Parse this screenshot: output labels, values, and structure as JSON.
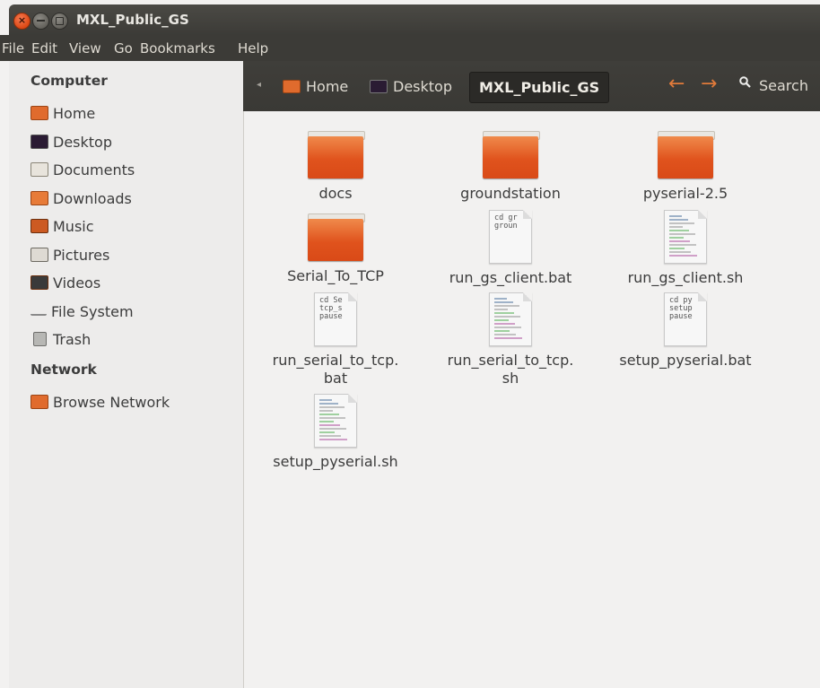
{
  "window": {
    "title": "MXL_Public_GS",
    "close_glyph": "×"
  },
  "menu": [
    "File",
    "Edit",
    "View",
    "Go",
    "Bookmarks",
    "Help"
  ],
  "sidebar": {
    "computer_header": "Computer",
    "items": [
      {
        "label": "Home",
        "icon": "home-folder-icon"
      },
      {
        "label": "Desktop",
        "icon": "desktop-icon"
      },
      {
        "label": "Documents",
        "icon": "documents-icon"
      },
      {
        "label": "Downloads",
        "icon": "downloads-icon"
      },
      {
        "label": "Music",
        "icon": "music-icon"
      },
      {
        "label": "Pictures",
        "icon": "pictures-icon"
      },
      {
        "label": "Videos",
        "icon": "videos-icon"
      },
      {
        "label": "File System",
        "icon": "drive-icon"
      },
      {
        "label": "Trash",
        "icon": "trash-icon"
      }
    ],
    "network_header": "Network",
    "network_items": [
      {
        "label": "Browse Network",
        "icon": "network-icon"
      }
    ]
  },
  "toolbar": {
    "breadcrumbs": [
      "Home",
      "Desktop",
      "MXL_Public_GS"
    ],
    "search_label": "Search",
    "accent_color": "#e07a3a"
  },
  "files": [
    {
      "name": "docs",
      "type": "folder"
    },
    {
      "name": "groundstation",
      "type": "folder"
    },
    {
      "name": "pyserial-2.5",
      "type": "folder"
    },
    {
      "name": "Serial_To_TCP",
      "type": "folder"
    },
    {
      "name": "run_gs_client.bat",
      "type": "text",
      "preview": "cd gr\ngroun"
    },
    {
      "name": "run_gs_client.sh",
      "type": "script"
    },
    {
      "name": "run_serial_to_tcp.\nbat",
      "type": "text",
      "preview": "cd Se\ntcp_s\npause"
    },
    {
      "name": "run_serial_to_tcp.\nsh",
      "type": "script"
    },
    {
      "name": "setup_pyserial.bat",
      "type": "text",
      "preview": "cd py\nsetup\npause"
    },
    {
      "name": "setup_pyserial.sh",
      "type": "script"
    }
  ]
}
